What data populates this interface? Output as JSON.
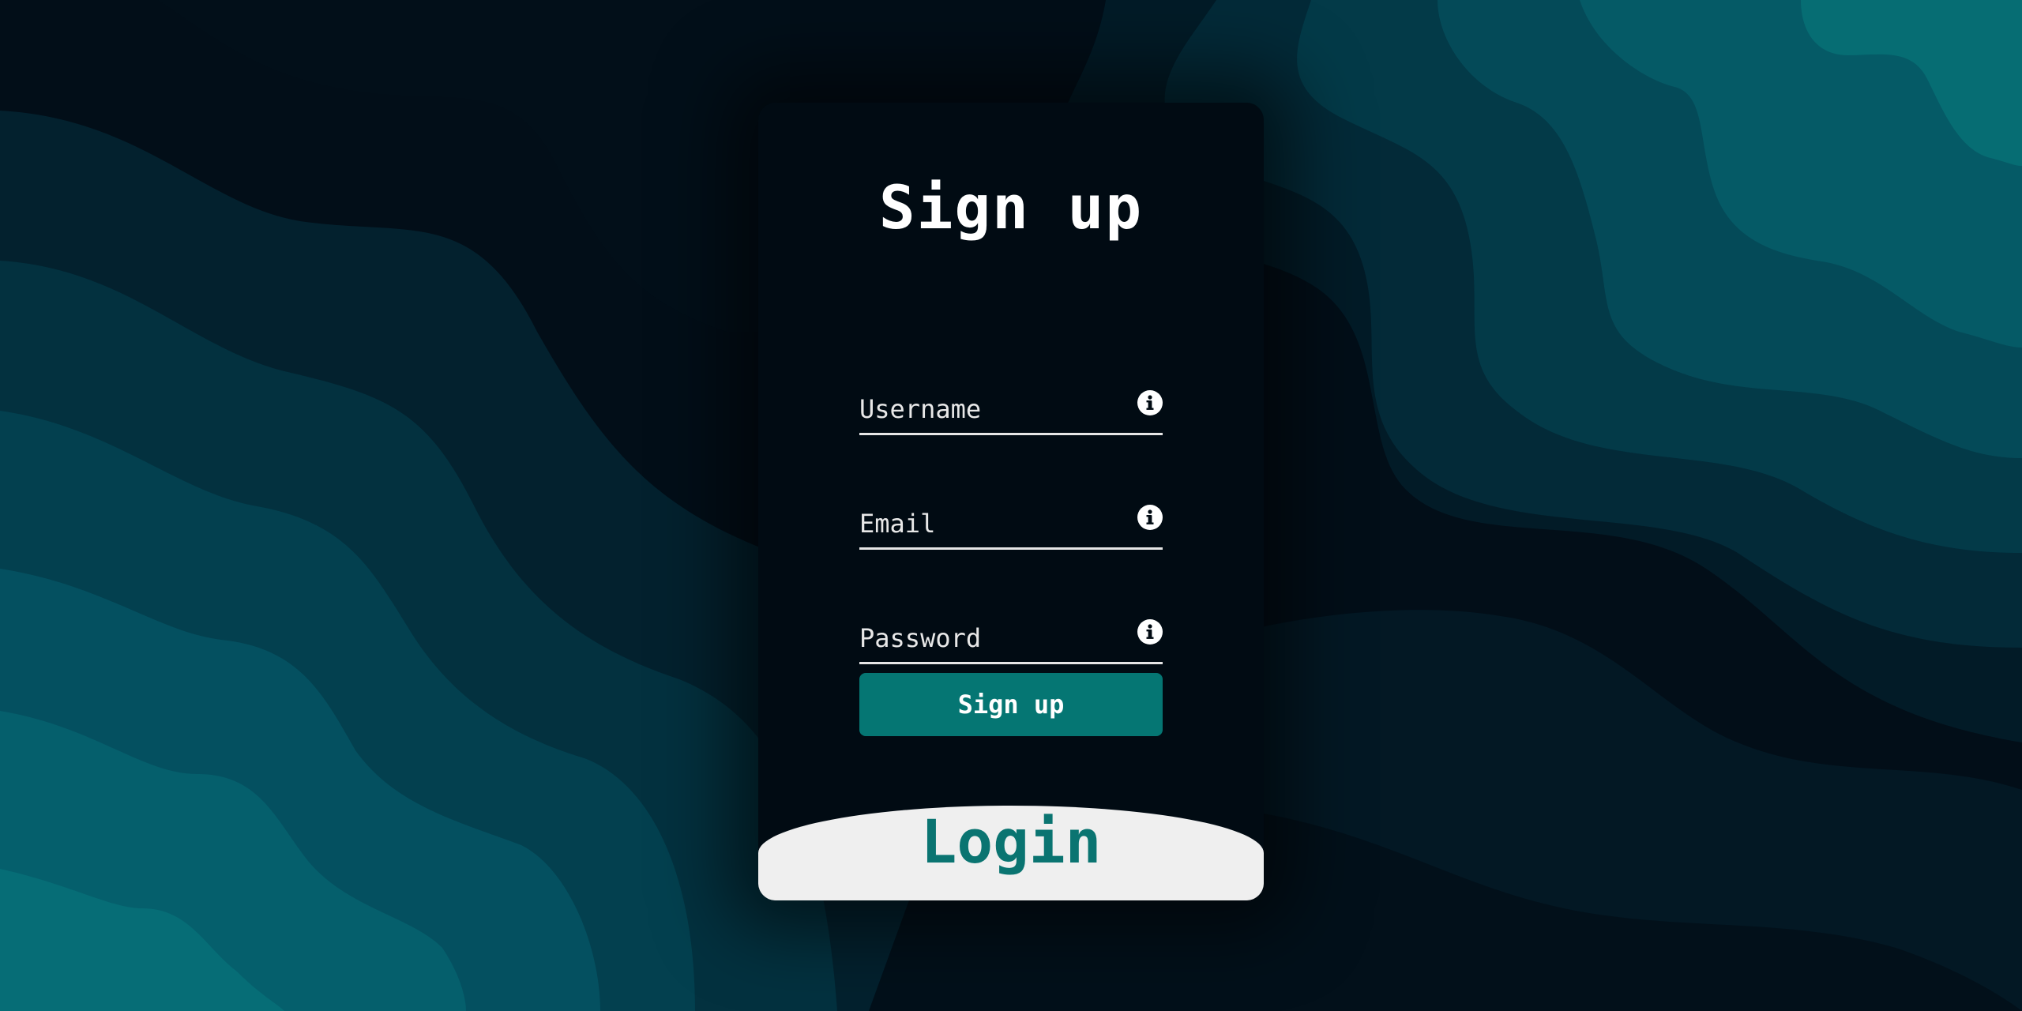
{
  "colors": {
    "accent": "#057673",
    "card": "#010b13",
    "login_panel": "#efefef",
    "text": "#ffffff"
  },
  "signup": {
    "title": "Sign up",
    "fields": [
      {
        "placeholder": "Username",
        "icon": "info-icon"
      },
      {
        "placeholder": "Email",
        "icon": "info-icon"
      },
      {
        "placeholder": "Password",
        "icon": "info-icon"
      }
    ],
    "button_label": "Sign up"
  },
  "login": {
    "label": "Login"
  }
}
